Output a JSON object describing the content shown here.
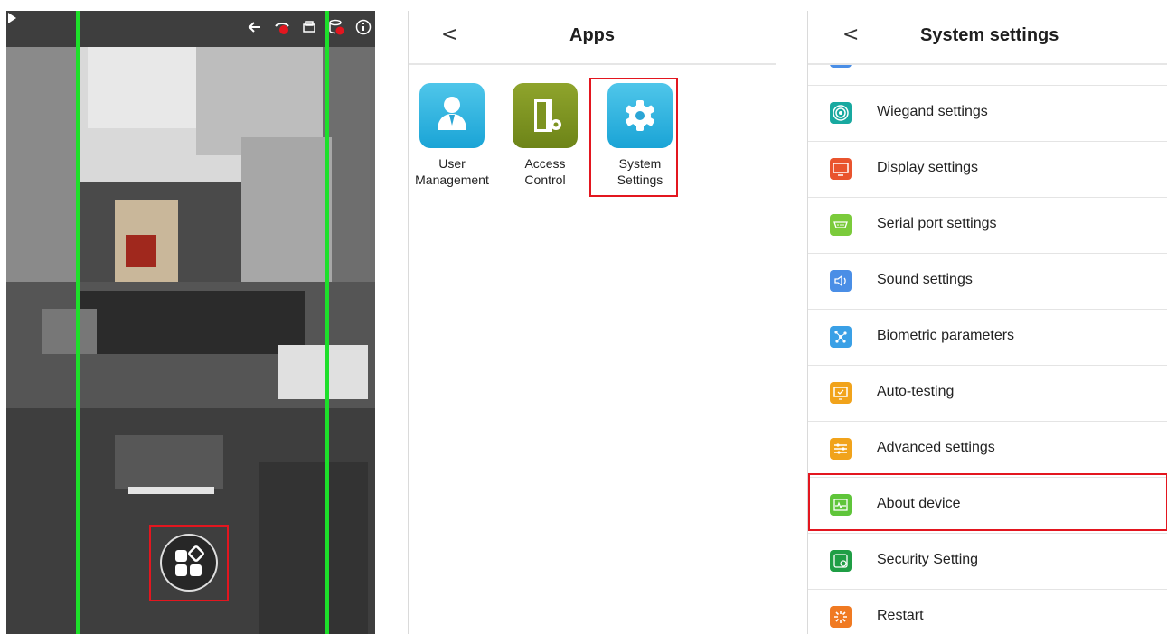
{
  "colors": {
    "guide_line": "#1de02a",
    "highlight": "#e3161f",
    "app_blue": "#1aa4d6",
    "app_olive": "#6d8418"
  },
  "camera": {
    "status_icons": [
      "back-arrow-icon",
      "no-camera-icon",
      "printer-icon",
      "database-error-icon",
      "info-icon"
    ],
    "apps_button_icon": "apps-grid-icon"
  },
  "apps_screen": {
    "back": "<",
    "title": "Apps",
    "apps": [
      {
        "label": "User\nManagement",
        "icon": "user-icon"
      },
      {
        "label": "Access\nControl",
        "icon": "door-gear-icon"
      },
      {
        "label": "System\nSettings",
        "icon": "gear-icon"
      }
    ]
  },
  "settings_screen": {
    "back": "<",
    "title": "System settings",
    "items": [
      {
        "label": "Wiegand settings",
        "icon": "wiegand-icon",
        "color": "#18a9a0"
      },
      {
        "label": "Display settings",
        "icon": "display-icon",
        "color": "#e9542e"
      },
      {
        "label": "Serial port settings",
        "icon": "serial-port-icon",
        "color": "#7bcb3b"
      },
      {
        "label": "Sound settings",
        "icon": "sound-icon",
        "color": "#4a8ee6"
      },
      {
        "label": "Biometric parameters",
        "icon": "biometric-icon",
        "color": "#3aa0e6"
      },
      {
        "label": "Auto-testing",
        "icon": "monitor-icon",
        "color": "#f1a31b"
      },
      {
        "label": "Advanced settings",
        "icon": "sliders-icon",
        "color": "#f1a31b"
      },
      {
        "label": "About device",
        "icon": "about-device-icon",
        "color": "#5fc53a"
      },
      {
        "label": "Security Setting",
        "icon": "security-icon",
        "color": "#1f9e45"
      },
      {
        "label": "Restart",
        "icon": "restart-icon",
        "color": "#f07a22"
      }
    ]
  }
}
